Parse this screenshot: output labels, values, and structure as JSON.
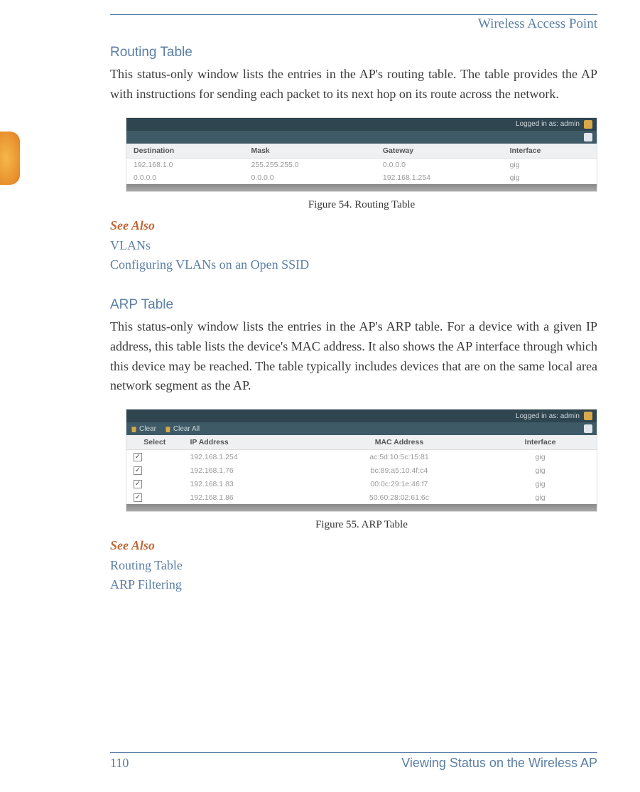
{
  "header": {
    "title": "Wireless Access Point"
  },
  "section1": {
    "heading": "Routing Table",
    "body": "This status-only window lists the entries in the AP's routing table. The table provides the AP with instructions for sending each packet to its next hop on its route across the network.",
    "caption": "Figure 54. Routing Table",
    "see_also_heading": "See Also",
    "links": [
      "VLANs",
      "Configuring VLANs on an Open SSID"
    ]
  },
  "fig54": {
    "login_text": "Logged in as: admin",
    "headers": [
      "Destination",
      "Mask",
      "Gateway",
      "Interface"
    ],
    "rows": [
      [
        "192.168.1.0",
        "255.255.255.0",
        "0.0.0.0",
        "gig"
      ],
      [
        "0.0.0.0",
        "0.0.0.0",
        "192.168.1.254",
        "gig"
      ]
    ]
  },
  "section2": {
    "heading": "ARP Table",
    "body": "This status-only window lists the entries in the AP's ARP table. For a device with a given IP address, this table lists the device's MAC address. It also shows the AP interface through which this device may be reached. The table typically includes devices that are on the same local area network segment as the AP.",
    "caption": "Figure 55. ARP Table",
    "see_also_heading": "See Also",
    "links": [
      "Routing Table",
      "ARP Filtering"
    ]
  },
  "fig55": {
    "login_text": "Logged in as: admin",
    "clear_label": "Clear",
    "clear_all_label": "Clear All",
    "headers": [
      "Select",
      "IP Address",
      "MAC Address",
      "Interface"
    ],
    "rows": [
      [
        "192.168.1.254",
        "ac:5d:10:5c:15:81",
        "gig"
      ],
      [
        "192.168.1.76",
        "bc:89:a5:10:4f:c4",
        "gig"
      ],
      [
        "192.168.1.83",
        "00:0c:29:1e:46:f7",
        "gig"
      ],
      [
        "192.168.1.86",
        "50:60:28:02:61:6c",
        "gig"
      ]
    ]
  },
  "footer": {
    "page_number": "110",
    "section_title": "Viewing Status on the Wireless AP"
  }
}
